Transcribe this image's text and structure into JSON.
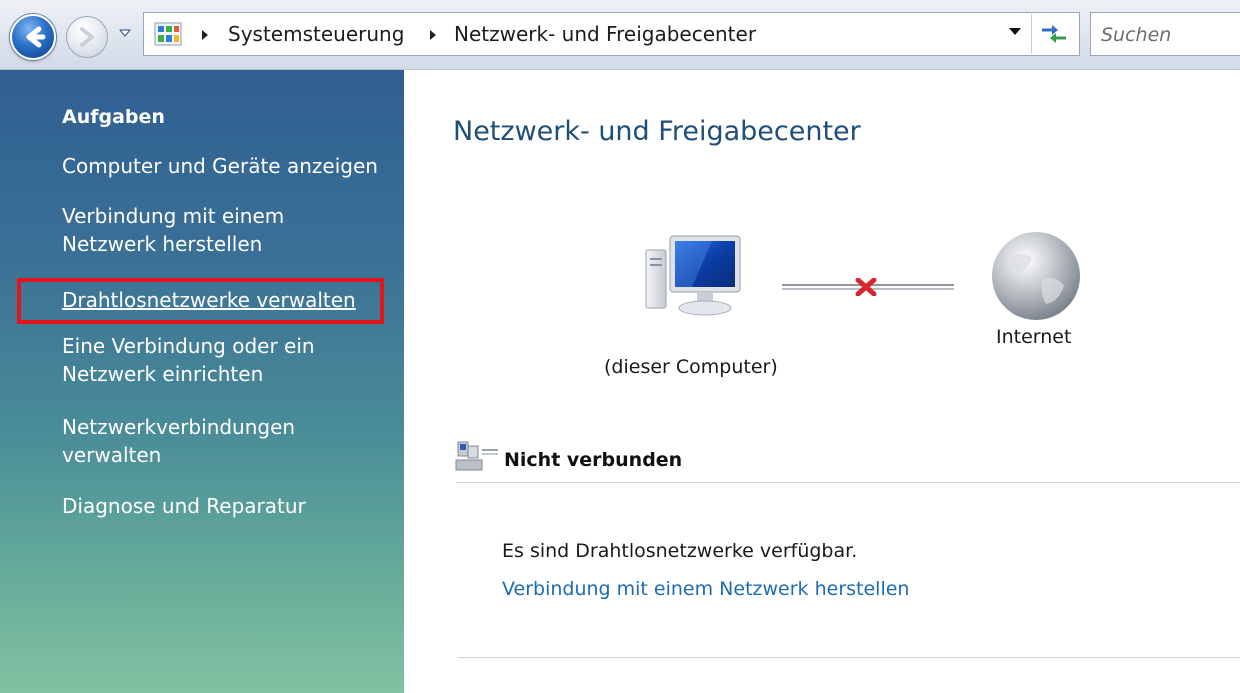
{
  "address_bar": {
    "breadcrumbs": [
      "Systemsteuerung",
      "Netzwerk- und Freigabecenter"
    ],
    "search_placeholder": "Suchen"
  },
  "sidebar": {
    "heading": "Aufgaben",
    "items": [
      {
        "lines": [
          "Computer und Geräte anzeigen"
        ]
      },
      {
        "lines": [
          "Verbindung mit einem",
          "Netzwerk herstellen"
        ]
      },
      {
        "lines": [
          "Drahtlosnetzwerke verwalten"
        ],
        "highlighted": true,
        "highlight_color": "#e4141b"
      },
      {
        "lines": [
          "Eine Verbindung oder ein",
          "Netzwerk einrichten"
        ]
      },
      {
        "lines": [
          "Netzwerkverbindungen",
          "verwalten"
        ]
      },
      {
        "lines": [
          "Diagnose und Reparatur"
        ]
      }
    ]
  },
  "main": {
    "title": "Netzwerk- und Freigabecenter",
    "map": {
      "computer_label": "(dieser Computer)",
      "internet_label": "Internet",
      "connection_state": "disconnected"
    },
    "status": {
      "title": "Nicht verbunden",
      "message": "Es sind Drahtlosnetzwerke verfügbar.",
      "link": "Verbindung mit einem Netzwerk herstellen"
    }
  },
  "icons": [
    "back-arrow-icon",
    "forward-arrow-icon",
    "history-dropdown-icon",
    "control-panel-icon",
    "breadcrumb-arrow-icon",
    "address-dropdown-icon",
    "refresh-icon",
    "computer-icon",
    "disconnected-x-icon",
    "globe-icon",
    "network-status-icon"
  ],
  "colors": {
    "title": "#1f4e79",
    "link": "#1e6bb5",
    "sidebar_top": "#2f5f92",
    "sidebar_bottom": "#82c2a3",
    "error_x": "#d9232d"
  }
}
